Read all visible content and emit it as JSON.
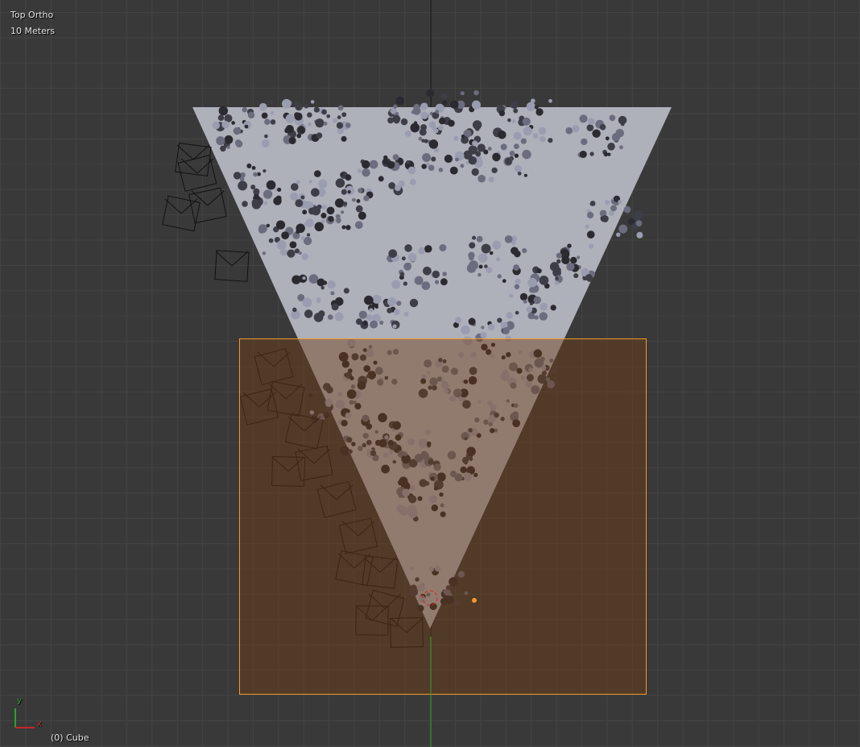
{
  "viewport": {
    "view_name": "Top Ortho",
    "scale_label": "10 Meters",
    "object_label": "(0) Cube"
  },
  "axis": {
    "x_label": "x",
    "y_label": "y"
  },
  "colors": {
    "selection": "#f39a28",
    "x_axis": "#c4272c",
    "y_axis": "#2aa22a",
    "plane": "#aeb0ba",
    "background": "#393939"
  },
  "objects": {
    "selected": "Cube"
  }
}
